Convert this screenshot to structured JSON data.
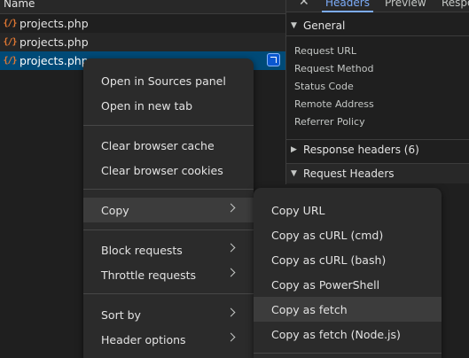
{
  "network": {
    "column_name": "Name",
    "rows": [
      {
        "name": "projects.php"
      },
      {
        "name": "projects.php"
      },
      {
        "name": "projects.php"
      }
    ],
    "file_icon_glyph": "{/}"
  },
  "details": {
    "tabs": {
      "close": "✕",
      "headers": "Headers",
      "preview": "Preview",
      "response": "Respo"
    },
    "general": {
      "title": "General",
      "keys": [
        "Request URL",
        "Request Method",
        "Status Code",
        "Remote Address",
        "Referrer Policy"
      ]
    },
    "response_headers": "Response headers (6)",
    "request_headers": "Request Headers",
    "triangle_open": "▼",
    "triangle_closed": "▶"
  },
  "context_menu": {
    "items": {
      "open_sources": "Open in Sources panel",
      "open_new_tab": "Open in new tab",
      "clear_cache": "Clear browser cache",
      "clear_cookies": "Clear browser cookies",
      "copy": "Copy",
      "block": "Block requests",
      "throttle": "Throttle requests",
      "sort_by": "Sort by",
      "header_options": "Header options"
    }
  },
  "copy_submenu": {
    "items": {
      "copy_url": "Copy URL",
      "copy_curl_cmd": "Copy as cURL (cmd)",
      "copy_curl_bash": "Copy as cURL (bash)",
      "copy_powershell": "Copy as PowerShell",
      "copy_fetch": "Copy as fetch",
      "copy_fetch_node": "Copy as fetch (Node.js)"
    }
  },
  "colors": {
    "background": "#1f1f1f",
    "selected_row": "#004a77",
    "accent": "#7cacf8",
    "menu_bg": "#2b2b2b",
    "menu_hover": "#3c3c3c",
    "php_icon": "#e37933"
  }
}
